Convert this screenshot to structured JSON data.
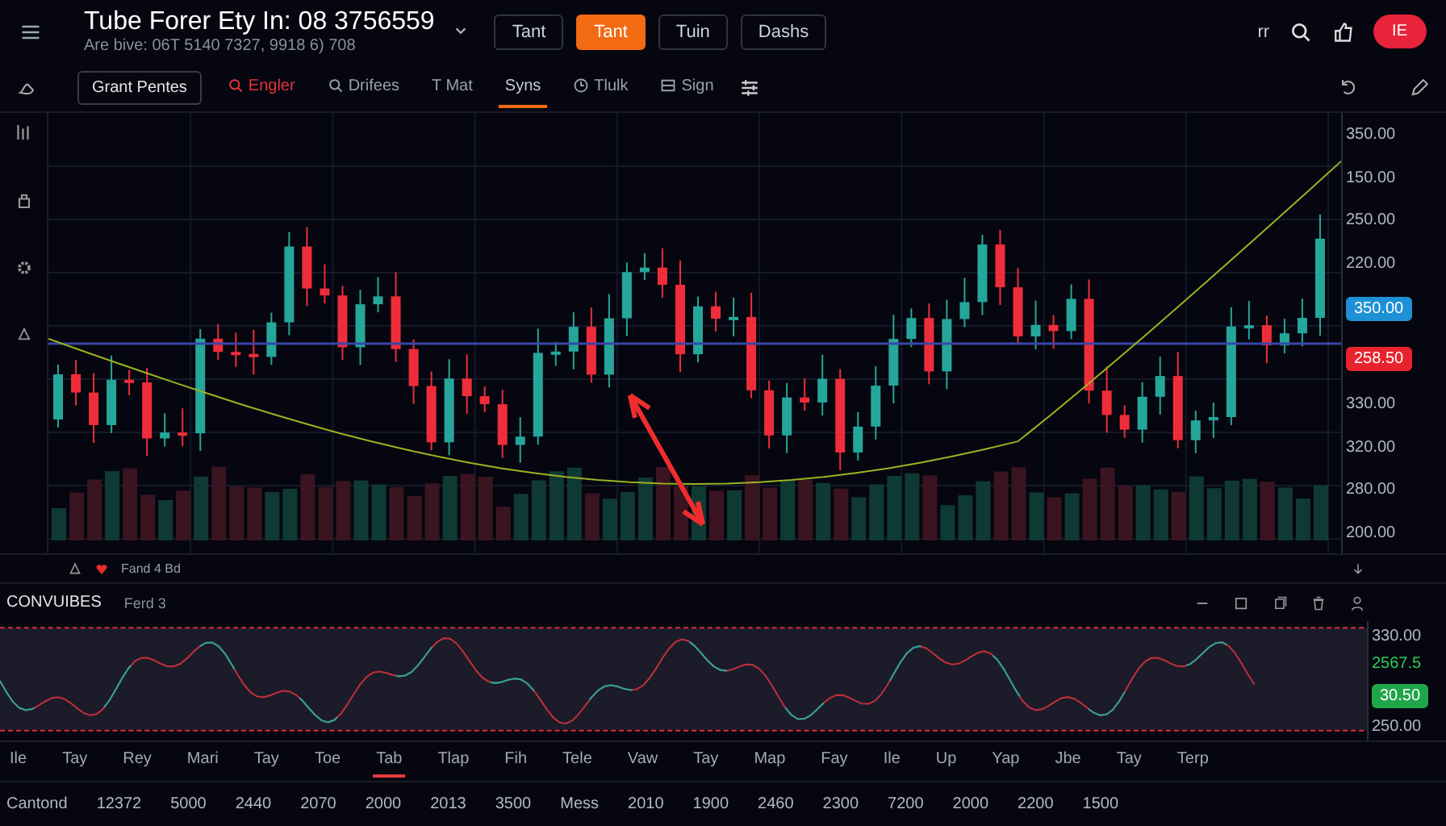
{
  "header": {
    "title": "Tube Forer Ety In: 08 3756559",
    "subtitle": "Are bive: 06T 5140 7327, 9918 6) 708",
    "tabs": [
      {
        "label": "Tant",
        "selected": false
      },
      {
        "label": "Tant",
        "selected": true
      },
      {
        "label": "Tuin",
        "selected": false
      },
      {
        "label": "Dashs",
        "selected": false
      }
    ],
    "right_text": "rr",
    "account_badge": "IE"
  },
  "toolbar": {
    "primary_button": "Grant Pentes",
    "items": [
      {
        "label": "Engler",
        "kind": "search",
        "selected": false
      },
      {
        "label": "Drifees",
        "kind": "search",
        "selected": false
      },
      {
        "label": "T Mat",
        "kind": "plain",
        "selected": false
      },
      {
        "label": "Syns",
        "kind": "plain",
        "selected": true
      },
      {
        "label": "Tlulk",
        "kind": "clock",
        "selected": false
      },
      {
        "label": "Sign",
        "kind": "list",
        "selected": false
      }
    ]
  },
  "price_axis": [
    {
      "kind": "label",
      "text": "350.00"
    },
    {
      "kind": "label",
      "text": "150.00"
    },
    {
      "kind": "label",
      "text": "250.00"
    },
    {
      "kind": "label",
      "text": "220.00"
    },
    {
      "kind": "tag",
      "text": "350.00",
      "color": "#1e90d6"
    },
    {
      "kind": "tag",
      "text": "258.50",
      "color": "#e8232e"
    },
    {
      "kind": "label",
      "text": "330.00"
    },
    {
      "kind": "label",
      "text": "320.00"
    },
    {
      "kind": "label",
      "text": "280.00"
    },
    {
      "kind": "label",
      "text": "200.00"
    }
  ],
  "legend": {
    "text": "Fand 4 Bd"
  },
  "indicator": {
    "title": "CONVUIBES",
    "param": "Ferd 3",
    "axis": [
      {
        "kind": "label",
        "text": "330.00"
      },
      {
        "kind": "green_text",
        "text": "2567.5"
      },
      {
        "kind": "tag",
        "text": "30.50",
        "color": "#1fa64a"
      },
      {
        "kind": "label",
        "text": "250.00"
      }
    ]
  },
  "dates": [
    {
      "label": "Ile",
      "selected": false
    },
    {
      "label": "Tay",
      "selected": false
    },
    {
      "label": "Rey",
      "selected": false
    },
    {
      "label": "Mari",
      "selected": false
    },
    {
      "label": "Tay",
      "selected": false
    },
    {
      "label": "Toe",
      "selected": false
    },
    {
      "label": "Tab",
      "selected": true
    },
    {
      "label": "Tlap",
      "selected": false
    },
    {
      "label": "Fih",
      "selected": false
    },
    {
      "label": "Tele",
      "selected": false
    },
    {
      "label": "Vaw",
      "selected": false
    },
    {
      "label": "Tay",
      "selected": false
    },
    {
      "label": "Map",
      "selected": false
    },
    {
      "label": "Fay",
      "selected": false
    },
    {
      "label": "Ile",
      "selected": false
    },
    {
      "label": "Up",
      "selected": false
    },
    {
      "label": "Yap",
      "selected": false
    },
    {
      "label": "Jbe",
      "selected": false
    },
    {
      "label": "Tay",
      "selected": false
    },
    {
      "label": "Terp",
      "selected": false
    }
  ],
  "footer": {
    "label": "Cantond",
    "values": [
      "12372",
      "5000",
      "2440",
      "2070",
      "2000",
      "2013",
      "3500",
      "Mess",
      "2010",
      "1900",
      "2460",
      "2300",
      "7200",
      "2000",
      "2200",
      "1500"
    ]
  }
}
